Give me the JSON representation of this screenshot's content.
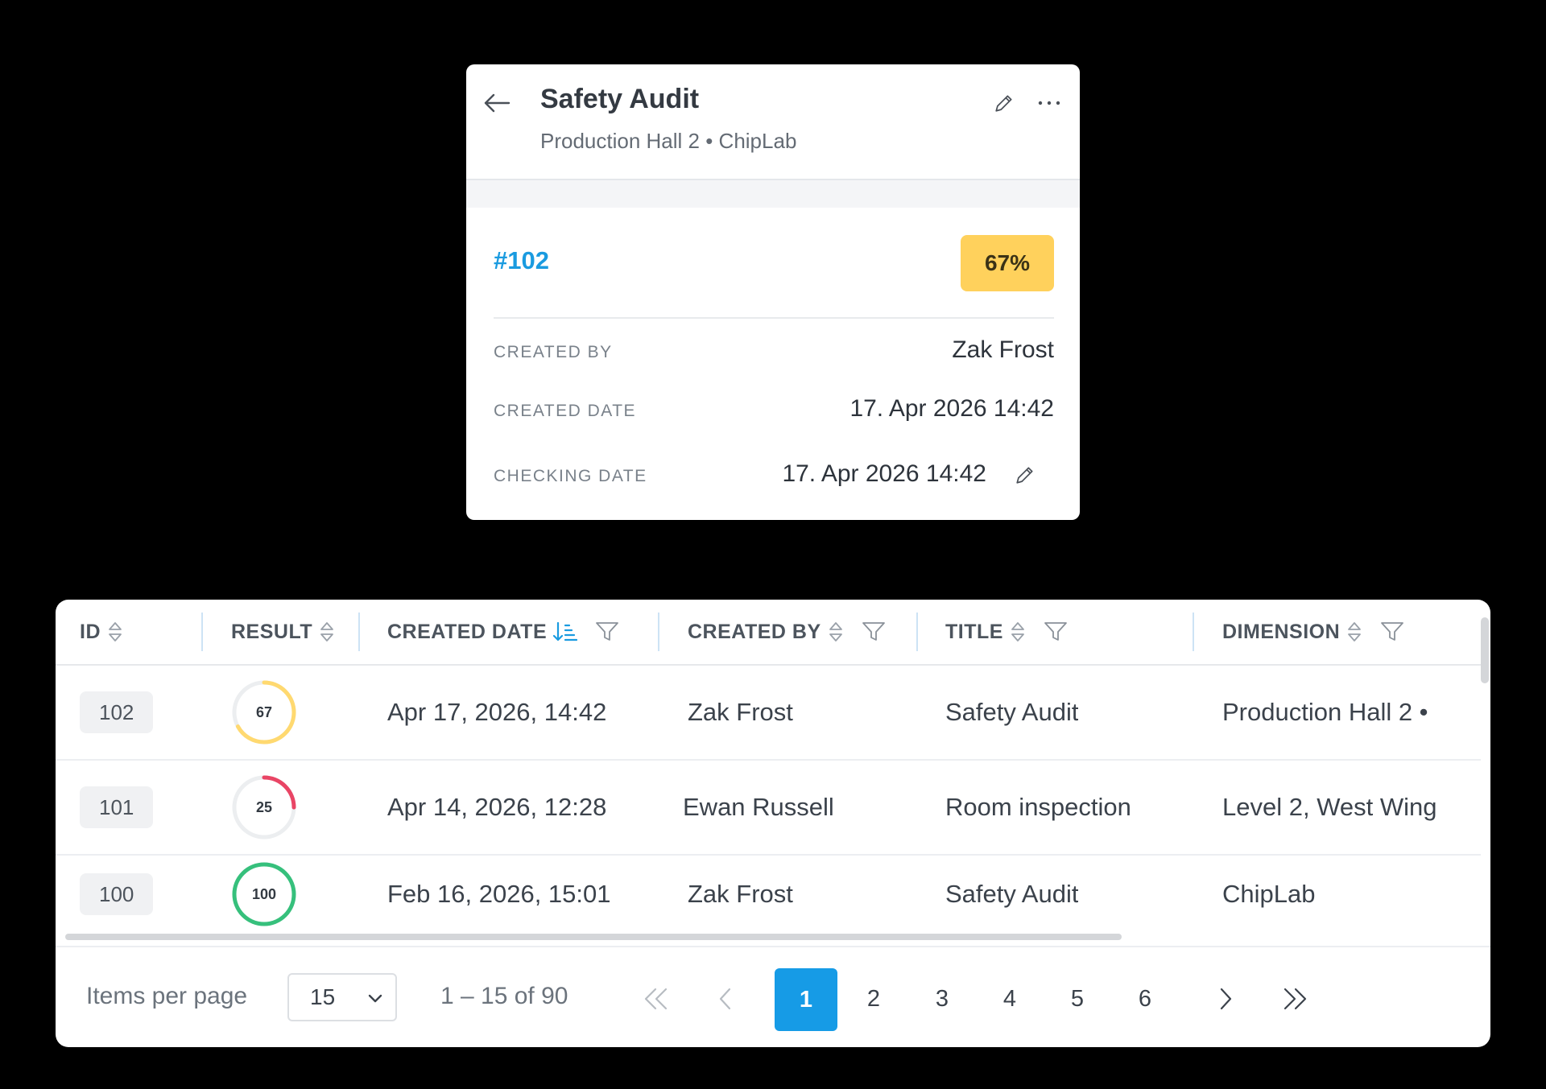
{
  "card": {
    "title": "Safety Audit",
    "subtitle": "Production Hall 2 • ChipLab",
    "id": "#102",
    "score": "67%",
    "score_color": "#ffd15c",
    "fields": [
      {
        "label": "CREATED BY",
        "value": "Zak Frost"
      },
      {
        "label": "CREATED DATE",
        "value": "17. Apr 2026 14:42"
      },
      {
        "label": "CHECKING DATE",
        "value": "17. Apr 2026 14:42"
      }
    ]
  },
  "table": {
    "columns": [
      {
        "label": "ID"
      },
      {
        "label": "RESULT"
      },
      {
        "label": "CREATED DATE"
      },
      {
        "label": "CREATED BY"
      },
      {
        "label": "TITLE"
      },
      {
        "label": "DIMENSION"
      }
    ],
    "rows": [
      {
        "id": "102",
        "result": 67,
        "result_label": "67",
        "result_color": "#ffd970",
        "created_date": "Apr 17, 2026, 14:42",
        "created_by": "Zak Frost",
        "title": "Safety Audit",
        "dimension": "Production Hall 2 •"
      },
      {
        "id": "101",
        "result": 25,
        "result_label": "25",
        "result_color": "#e94565",
        "created_date": "Apr 14, 2026, 12:28",
        "created_by": "Ewan Russell",
        "title": "Room inspection",
        "dimension": "Level 2, West Wing"
      },
      {
        "id": "100",
        "result": 100,
        "result_label": "100",
        "result_color": "#36c07c",
        "created_date": "Feb 16, 2026, 15:01",
        "created_by": "Zak Frost",
        "title": "Safety Audit",
        "dimension": "ChipLab"
      }
    ]
  },
  "pagination": {
    "items_per_page_label": "Items per page",
    "items_per_page": "15",
    "range": "1 – 15 of 90",
    "pages": [
      "1",
      "2",
      "3",
      "4",
      "5",
      "6"
    ],
    "current_page": "1",
    "accent": "#169be6"
  }
}
